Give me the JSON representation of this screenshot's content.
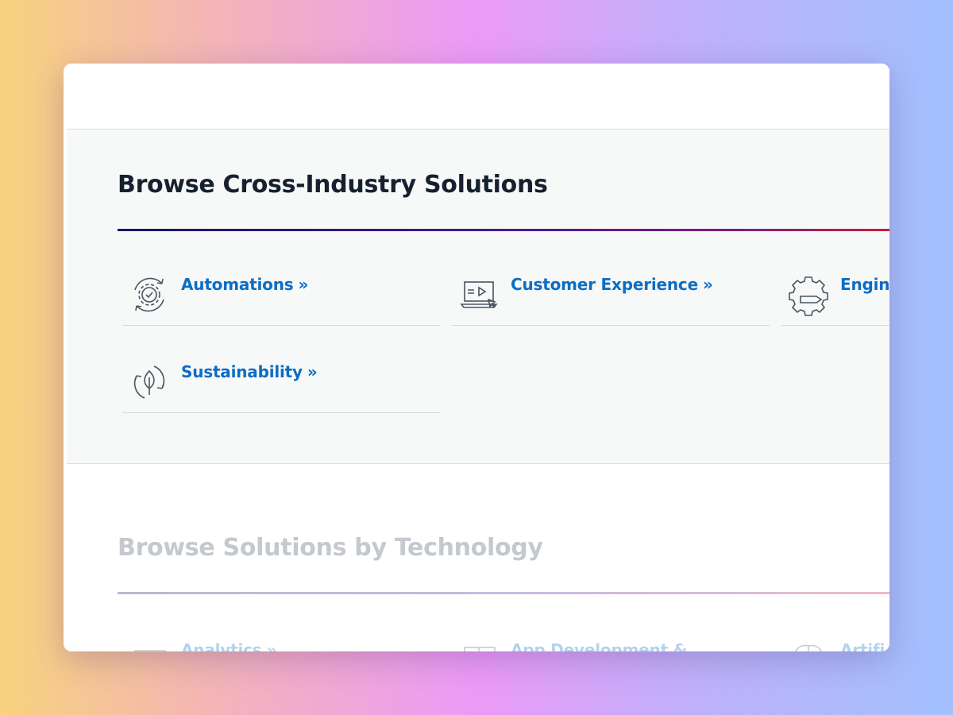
{
  "cross_industry": {
    "title": "Browse Cross-Industry Solutions",
    "items": [
      {
        "label": "Automations",
        "icon": "gear-cycle-icon"
      },
      {
        "label": "Customer Experience",
        "icon": "laptop-video-icon"
      },
      {
        "label": "Engin",
        "icon": "gear-pencil-icon"
      },
      {
        "label": "Sustainability",
        "icon": "leaf-cycle-icon"
      }
    ],
    "chevron": "»"
  },
  "technology": {
    "title": "Browse Solutions by Technology",
    "items": [
      {
        "label": "Analytics",
        "icon": "chart-icon"
      },
      {
        "label": "App Development &",
        "icon": "puzzle-screen-icon"
      },
      {
        "label": "Artifi",
        "icon": "brain-icon"
      }
    ],
    "chevron": "»"
  },
  "colors": {
    "link": "#0b6ec5",
    "heading": "#16212f",
    "rule_start": "#1b1464",
    "rule_end": "#c4203a"
  }
}
